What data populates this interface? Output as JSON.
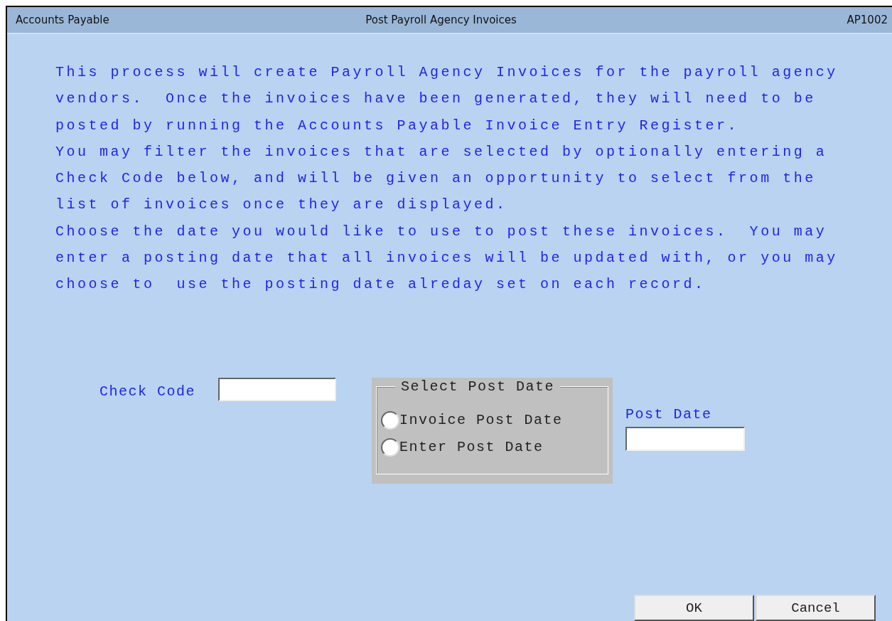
{
  "window": {
    "module": "Accounts Payable",
    "title": "Post Payroll Agency Invoices",
    "code": "AP1002"
  },
  "instructions": [
    "This process will create Payroll Agency Invoices for the payroll agency",
    "vendors.  Once the invoices have been generated, they will need to be",
    "posted by running the Accounts Payable Invoice Entry Register.",
    "You may filter the invoices that are selected by optionally entering a",
    "Check Code below, and will be given an opportunity to select from the",
    "list of invoices once they are displayed.",
    "Choose the date you would like to use to post these invoices.  You may",
    "enter a posting date that all invoices will be updated with, or you may",
    "choose to  use the posting date alreday set on each record."
  ],
  "check_code": {
    "label": "Check Code"
  },
  "post_date_group": {
    "title": "Select Post Date",
    "options": [
      {
        "label": "Invoice Post Date",
        "selected": false
      },
      {
        "label": "Enter Post Date",
        "selected": false
      }
    ]
  },
  "post_date": {
    "label": "Post Date"
  },
  "buttons": [
    "OK",
    "Cancel"
  ]
}
